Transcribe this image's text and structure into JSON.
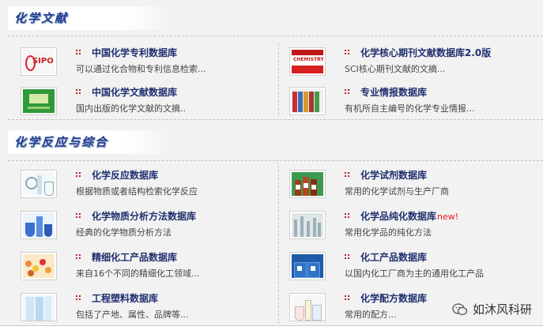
{
  "sections": [
    {
      "title": "化学文献",
      "items": [
        {
          "title": "中国化学专利数据库",
          "desc": "可以通过化合物和专利信息检索..."
        },
        {
          "title": "化学核心期刊文献数据库2.0版",
          "desc": "SCI核心期刊文献的文摘..."
        },
        {
          "title": "中国化学文献数据库",
          "desc": "国内出版的化学文献的文摘.."
        },
        {
          "title": "专业情报数据库",
          "desc": "有机所自主编号的化学专业情报..."
        }
      ]
    },
    {
      "title": "化学反应与综合",
      "items": [
        {
          "title": "化学反应数据库",
          "desc": "根据物质或者结构检索化学反应"
        },
        {
          "title": "化学试剂数据库",
          "desc": "常用的化学试剂与生产厂商"
        },
        {
          "title": "化学物质分析方法数据库",
          "desc": "经典的化学物质分析方法"
        },
        {
          "title": "化学品纯化数据库",
          "desc": "常用化学品的纯化方法",
          "badge": "new!"
        },
        {
          "title": "精细化工产品数据库",
          "desc": "来自16个不同的精细化工领域..."
        },
        {
          "title": "化工产品数据库",
          "desc": "以国内化工厂商为主的通用化工产品"
        },
        {
          "title": "工程塑料数据库",
          "desc": "包括了产地、属性、品牌等..."
        },
        {
          "title": "化学配方数据库",
          "desc": "常用的配方..."
        }
      ]
    }
  ],
  "thumb_labels": {
    "sipo": "SIPO",
    "journal": "CHEMISTRY"
  },
  "watermark": "如沐风科研",
  "colors": {
    "title": "#1f2f6f",
    "bullet": "#c0202a",
    "new": "#e21b1b",
    "section": "#1f3f8f"
  }
}
